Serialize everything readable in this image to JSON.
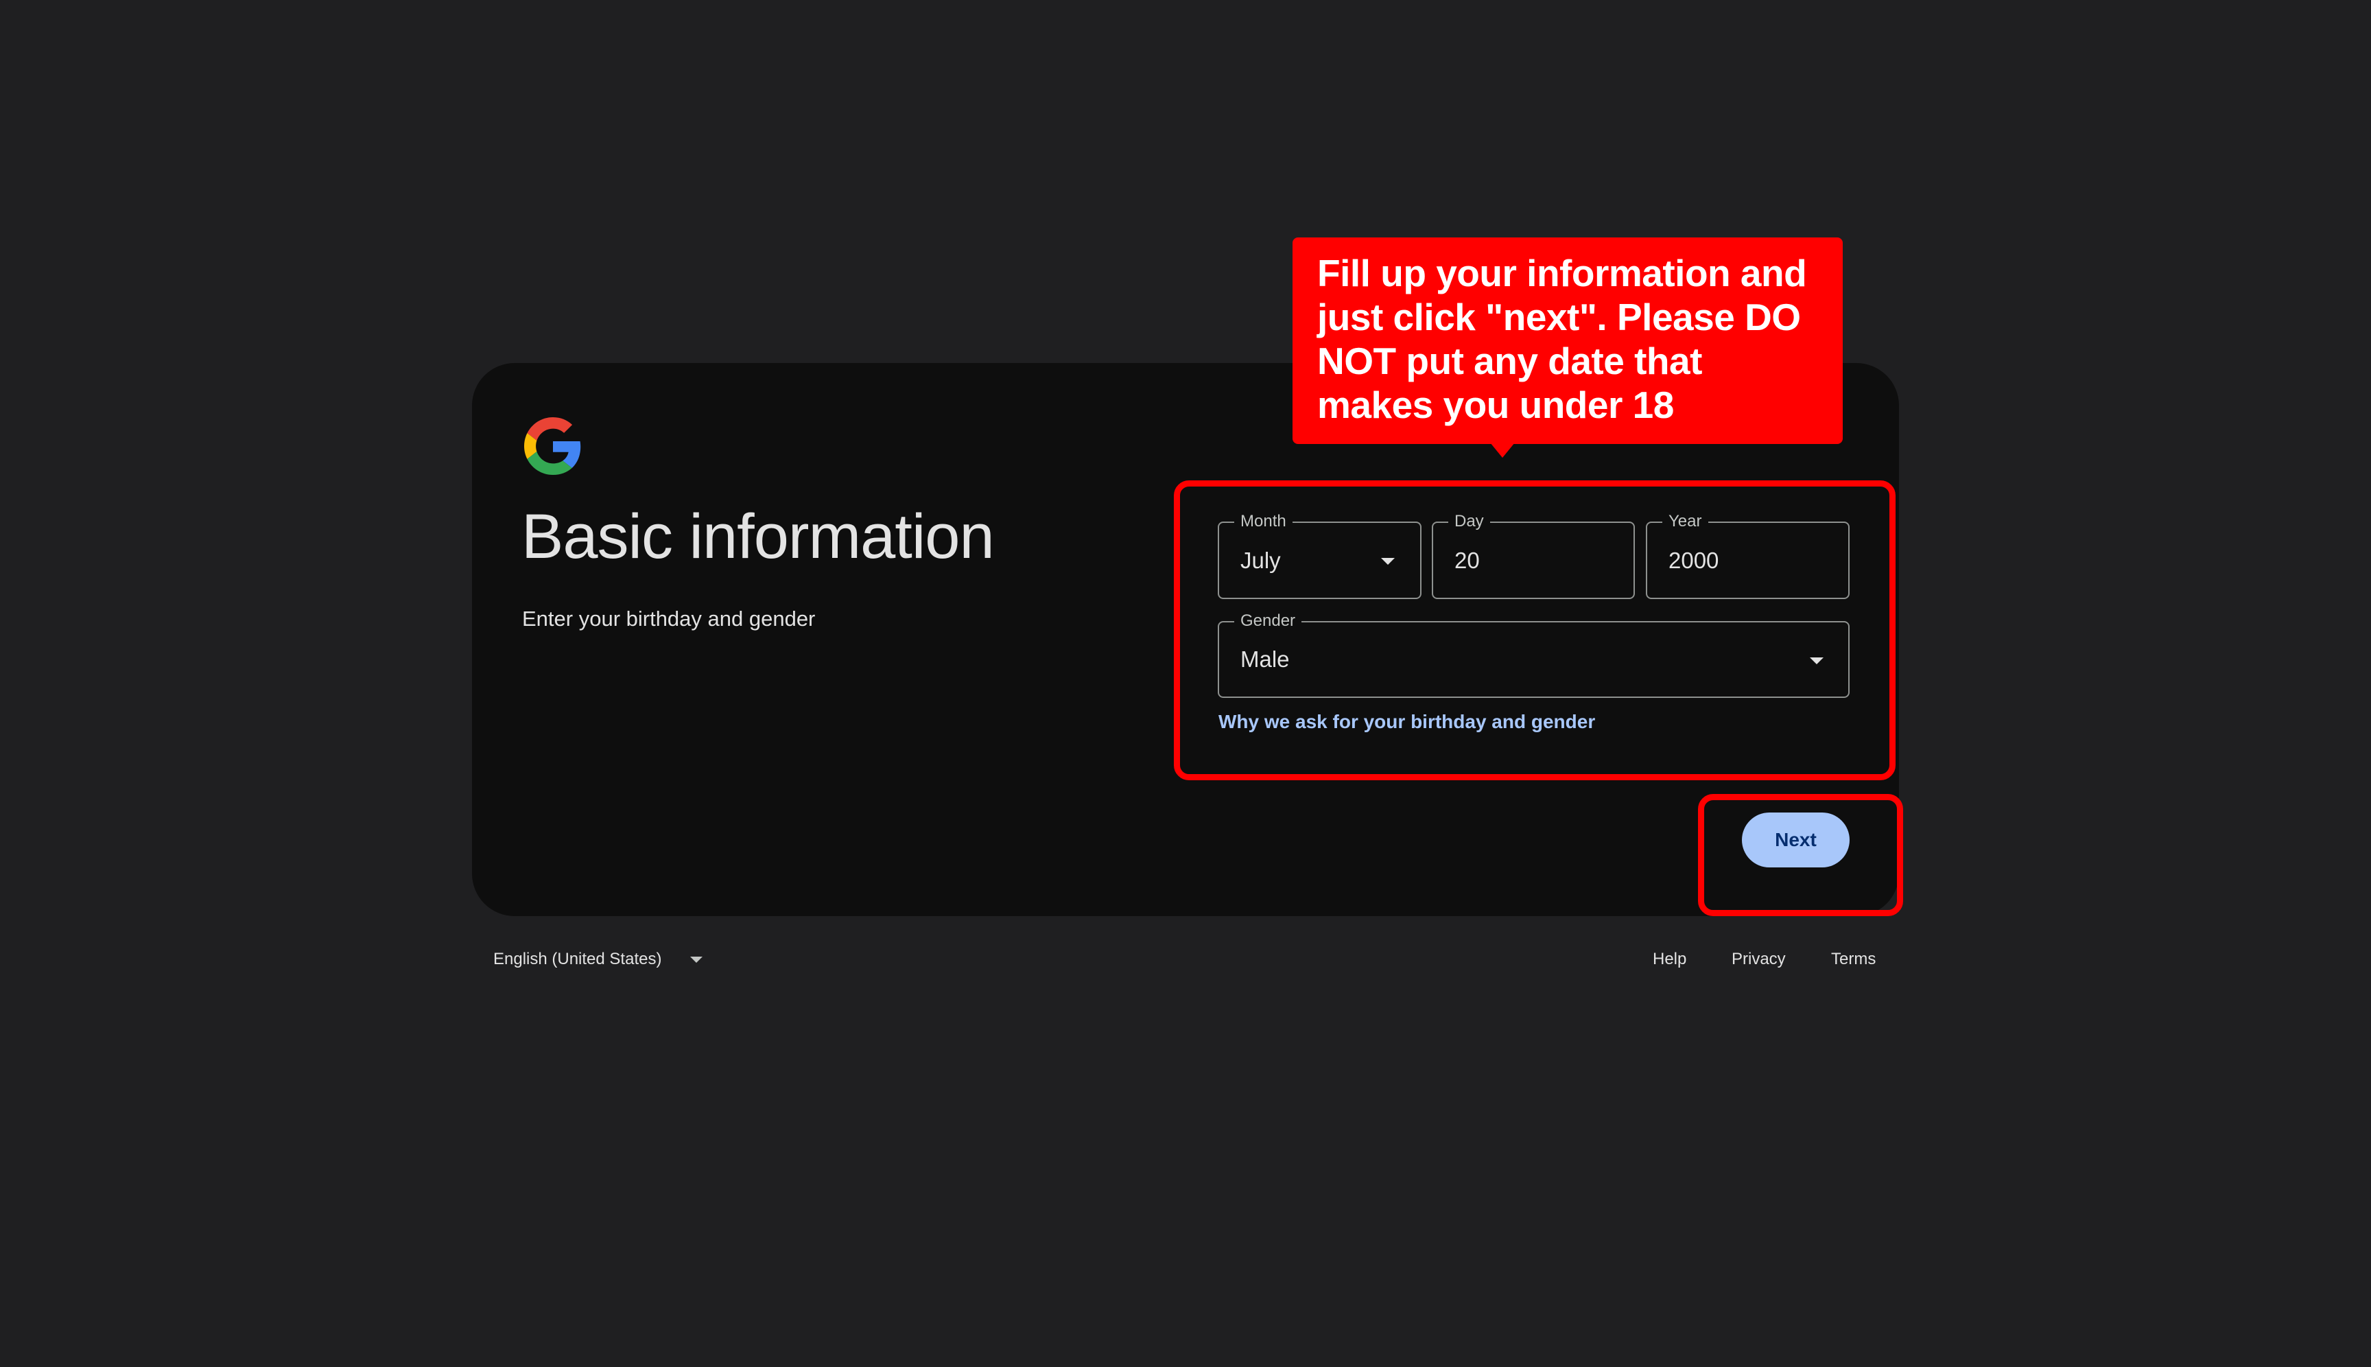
{
  "header": {
    "title": "Basic information",
    "subtitle": "Enter your birthday and gender"
  },
  "form": {
    "month": {
      "label": "Month",
      "value": "July"
    },
    "day": {
      "label": "Day",
      "value": "20"
    },
    "year": {
      "label": "Year",
      "value": "2000"
    },
    "gender": {
      "label": "Gender",
      "value": "Male"
    },
    "why_link": "Why we ask for your birthday and gender",
    "next_label": "Next"
  },
  "annotation": {
    "callout_text": "Fill up your information and just click \"next\". Please DO NOT put any date that makes you under 18"
  },
  "footer": {
    "language": "English (United States)",
    "help": "Help",
    "privacy": "Privacy",
    "terms": "Terms"
  },
  "colors": {
    "background": "#1f1f21",
    "card": "#0e0e0e",
    "accent_link": "#a8c7fa",
    "button_bg": "#a8c7fa",
    "annotation_red": "#ff0000"
  },
  "icons": {
    "logo": "google-g-icon",
    "dropdown": "chevron-down-icon"
  }
}
